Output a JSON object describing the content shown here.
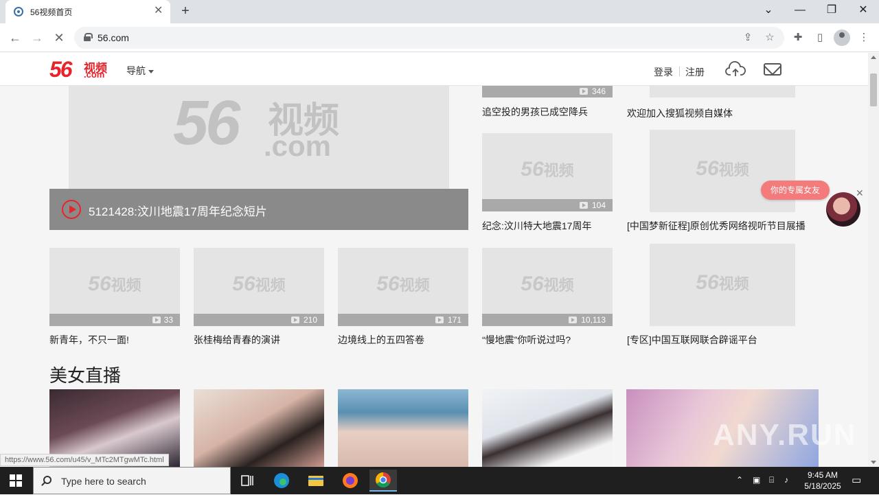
{
  "browser": {
    "tab_title": "56视频首页",
    "tab_close_glyph": "✕",
    "new_tab_glyph": "+",
    "url": "56.com",
    "window_controls": {
      "dropdown": "⌄",
      "minimize": "—",
      "restore": "❐",
      "close": "✕"
    }
  },
  "header": {
    "logo_num": "56",
    "logo_cn": "视频",
    "logo_com": ".com",
    "nav_label": "导航",
    "login": "登录",
    "register": "注册"
  },
  "hero": {
    "placeholder_num": "56",
    "placeholder_cn": "视频",
    "placeholder_com": ".com",
    "title": "5121428:汶川地震17周年纪念短片"
  },
  "placeholder": {
    "num": "56",
    "cn": "视频",
    "com": ".com"
  },
  "right_top": [
    {
      "count": "346",
      "caption": "追空投的男孩已成空降兵"
    },
    {
      "count": "",
      "caption": "欢迎加入搜狐视频自媒体"
    }
  ],
  "right_mid": [
    {
      "count": "104",
      "caption": "纪念:汶川特大地震17周年"
    },
    {
      "count": "",
      "caption": "[中国梦新征程]原创优秀网络视听节目展播"
    }
  ],
  "video_row": [
    {
      "count": "33",
      "caption": "新青年，不只一面!"
    },
    {
      "count": "210",
      "caption": "张桂梅给青春的演讲"
    },
    {
      "count": "171",
      "caption": "边境线上的五四答卷"
    },
    {
      "count": "10,113",
      "caption": "“慢地震”你听说过吗?"
    },
    {
      "count": "",
      "caption": "[专区]中国互联网联合辟谣平台"
    }
  ],
  "live_section": {
    "title": "美女直播"
  },
  "float_ad": {
    "label": "你的专属女友",
    "close": "✕"
  },
  "status_url": "https://www.56.com/u45/v_MTc2MTgwMTc.html",
  "watermark": "ANY.RUN",
  "taskbar": {
    "search_placeholder": "Type here to search",
    "time": "9:45 AM",
    "date": "5/18/2025"
  }
}
